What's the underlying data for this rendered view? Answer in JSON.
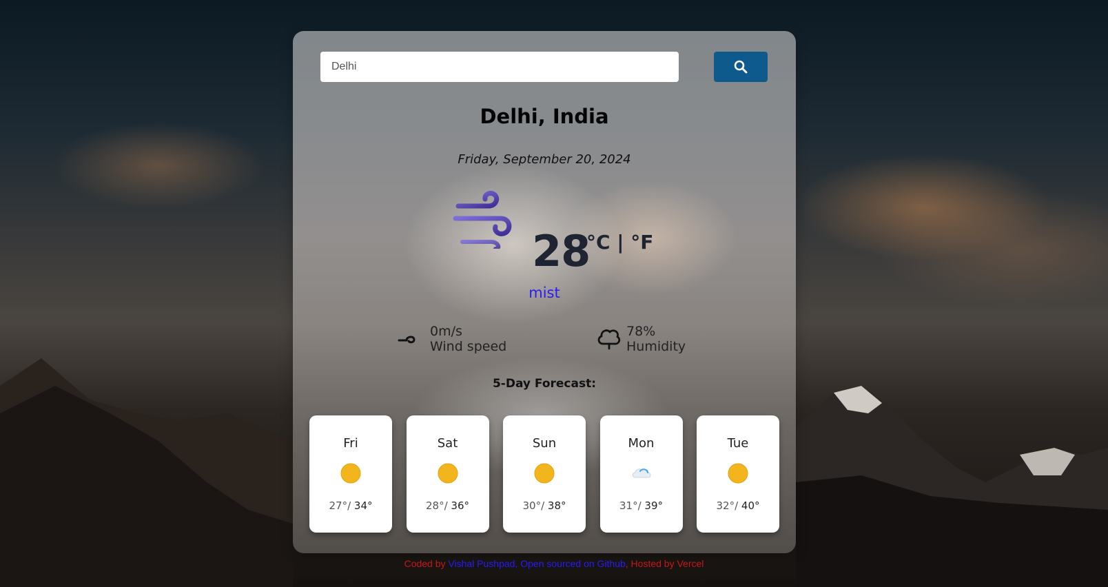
{
  "search": {
    "value": "Delhi",
    "placeholder": ""
  },
  "location": {
    "title": "Delhi, India"
  },
  "date": "Friday, September 20, 2024",
  "current": {
    "temperature": "28",
    "units": "°C | °F",
    "condition": "mist",
    "icon": "wind-icon"
  },
  "details": {
    "wind": {
      "value": "0m/s",
      "label": "Wind speed",
      "icon": "wind-small-icon"
    },
    "humidity": {
      "value": "78%",
      "label": "Humidity",
      "icon": "humidity-cloud-icon"
    }
  },
  "forecast": {
    "title": "5-Day Forecast:",
    "days": [
      {
        "day": "Fri",
        "min": "27°/",
        "max": "34°",
        "icon": "sun-icon"
      },
      {
        "day": "Sat",
        "min": "28°/",
        "max": "36°",
        "icon": "sun-icon"
      },
      {
        "day": "Sun",
        "min": "30°/",
        "max": "38°",
        "icon": "sun-icon"
      },
      {
        "day": "Mon",
        "min": "31°/",
        "max": "39°",
        "icon": "cloud-icon"
      },
      {
        "day": "Tue",
        "min": "32°/",
        "max": "40°",
        "icon": "sun-icon"
      }
    ]
  },
  "footer": {
    "prefix": "Coded by ",
    "author": "Vishal Pushpad",
    "sep": ", ",
    "repo": "Open sourced on Github",
    "suffix": ", Hosted by Vercel"
  },
  "colors": {
    "accent": "#0f5a8c",
    "condition": "#2a1bf5",
    "footer": "#c81818"
  }
}
